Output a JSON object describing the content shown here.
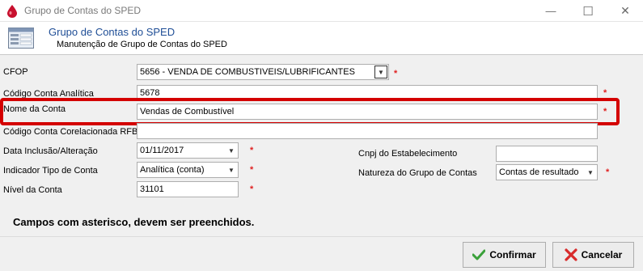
{
  "window": {
    "title": "Grupo de Contas do SPED",
    "minimize_glyph": "—",
    "maximize_glyph": "☐",
    "close_glyph": "✕"
  },
  "header": {
    "title": "Grupo de Contas do SPED",
    "subtitle": "Manutenção de Grupo de Contas do SPED"
  },
  "form": {
    "cfop": {
      "label": "CFOP",
      "value": "5656  - VENDA DE COMBUSTIVEIS/LUBRIFICANTES"
    },
    "codigo_conta_analitica": {
      "label": "Código Conta Analítica",
      "value": "5678"
    },
    "nome_conta": {
      "label": "Nome da Conta",
      "value": "Vendas de Combustível"
    },
    "codigo_conta_corelacionada": {
      "label": "Código Conta Corelacionada RFB",
      "value": ""
    },
    "data_inclusao": {
      "label": "Data Inclusão/Alteração",
      "value": "01/11/2017"
    },
    "indicador_tipo": {
      "label": "Indicador Tipo de Conta",
      "value": "Analítica (conta)"
    },
    "nivel_conta": {
      "label": "Nível da Conta",
      "value": "31101"
    },
    "cnpj": {
      "label": "Cnpj do Estabelecimento",
      "value": ""
    },
    "natureza": {
      "label": "Natureza do Grupo de Contas",
      "value": "Contas de resultado"
    },
    "required_mark": "*"
  },
  "note": "Campos com asterisco, devem ser preenchidos.",
  "buttons": {
    "confirm": "Confirmar",
    "cancel": "Cancelar"
  },
  "colors": {
    "header_title": "#1f4e96",
    "required": "#e02020",
    "highlight": "#d40000"
  },
  "icons": [
    "app-icon",
    "form-icon",
    "check-icon",
    "cancel-x-icon",
    "dropdown-arrow-icon"
  ]
}
